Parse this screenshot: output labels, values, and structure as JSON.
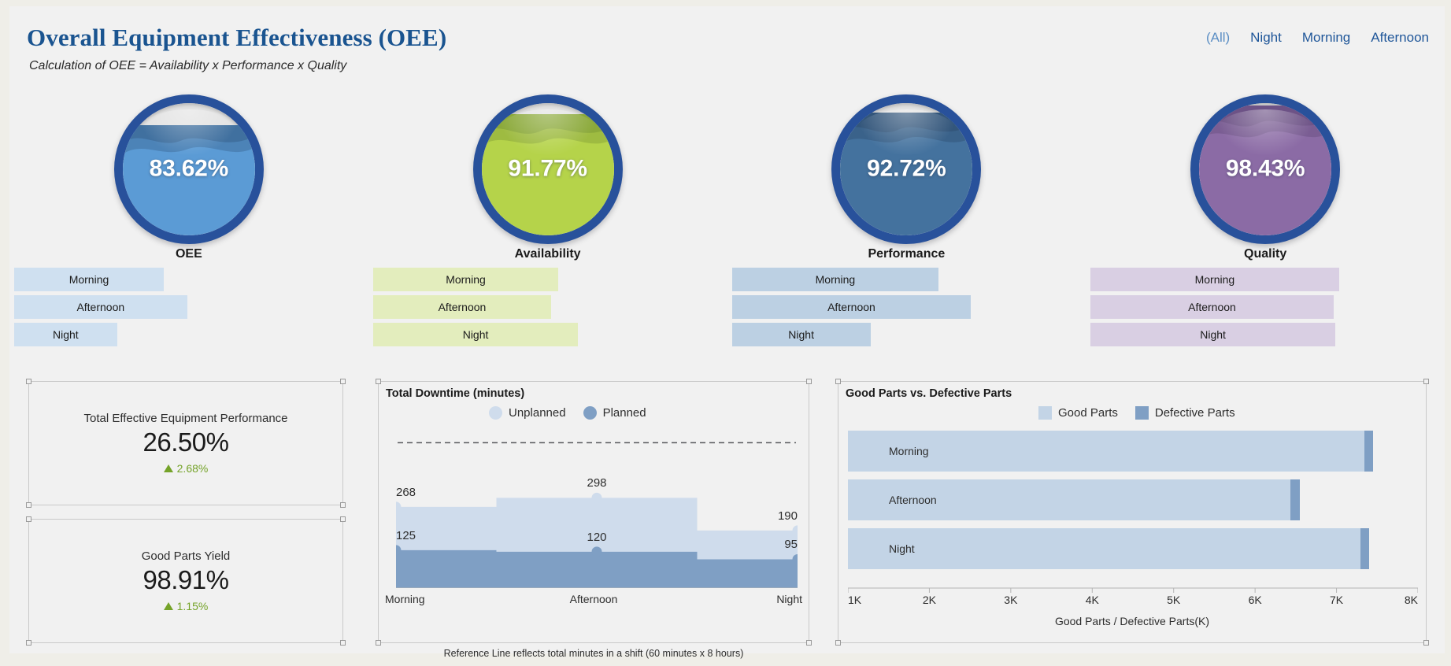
{
  "header": {
    "title": "Overall Equipment Effectiveness (OEE)",
    "subtitle": "Calculation of OEE = Availability x Performance x Quality",
    "filters": [
      {
        "label": "(All)",
        "selected": true
      },
      {
        "label": "Night",
        "selected": false
      },
      {
        "label": "Morning",
        "selected": false
      },
      {
        "label": "Afternoon",
        "selected": false
      }
    ]
  },
  "gauges": [
    {
      "title": "OEE",
      "value": "83.62%",
      "fill_pct": 83.62,
      "color": "#5b9bd5",
      "color_dark": "#3f6f9e",
      "bar_color": "#cfe0f0",
      "shifts": [
        {
          "label": "Morning",
          "width_pct": 43.0
        },
        {
          "label": "Afternoon",
          "width_pct": 49.5
        },
        {
          "label": "Night",
          "width_pct": 30.0
        }
      ]
    },
    {
      "title": "Availability",
      "value": "91.77%",
      "fill_pct": 91.77,
      "color": "#b5d34a",
      "color_dark": "#8aa83a",
      "bar_color": "#e3edbd",
      "shifts": [
        {
          "label": "Morning",
          "width_pct": 53.0
        },
        {
          "label": "Afternoon",
          "width_pct": 51.0
        },
        {
          "label": "Night",
          "width_pct": 58.5
        }
      ]
    },
    {
      "title": "Performance",
      "value": "92.72%",
      "fill_pct": 92.72,
      "color": "#44729e",
      "color_dark": "#33567a",
      "bar_color": "#bcd0e3",
      "shifts": [
        {
          "label": "Morning",
          "width_pct": 59.0
        },
        {
          "label": "Afternoon",
          "width_pct": 68.0
        },
        {
          "label": "Night",
          "width_pct": 40.0
        }
      ]
    },
    {
      "title": "Quality",
      "value": "98.43%",
      "fill_pct": 98.43,
      "color": "#8b6ba5",
      "color_dark": "#6d5285",
      "bar_color": "#d9cfe3",
      "shifts": [
        {
          "label": "Morning",
          "width_pct": 70.5
        },
        {
          "label": "Afternoon",
          "width_pct": 69.0
        },
        {
          "label": "Night",
          "width_pct": 69.5
        }
      ]
    }
  ],
  "kpis": [
    {
      "label": "Total Effective Equipment Performance",
      "value": "26.50%",
      "delta": "2.68%",
      "delta_direction": "up",
      "delta_color": "#75a329"
    },
    {
      "label": "Good Parts Yield",
      "value": "98.91%",
      "delta": "1.15%",
      "delta_direction": "up",
      "delta_color": "#75a329"
    }
  ],
  "downtime_panel": {
    "title": "Total Downtime (minutes)",
    "caption": "Reference Line reflects total minutes in a shift (60 minutes x 8 hours)",
    "legend": [
      {
        "label": "Unplanned",
        "color": "#cfdcec",
        "shape": "circle"
      },
      {
        "label": "Planned",
        "color": "#7f9fc4",
        "shape": "circle"
      }
    ]
  },
  "goodparts_panel": {
    "title": "Good Parts vs. Defective Parts",
    "axis_label": "Good Parts / Defective Parts(K)",
    "legend": [
      {
        "label": "Good Parts",
        "color": "#c3d4e6",
        "shape": "square"
      },
      {
        "label": "Defective Parts",
        "color": "#7f9fc4",
        "shape": "square"
      }
    ]
  },
  "chart_data": [
    {
      "type": "area",
      "id": "total-downtime",
      "title": "Total Downtime (minutes)",
      "subtype": "stepped-area",
      "categories": [
        "Morning",
        "Afternoon",
        "Night"
      ],
      "series": [
        {
          "name": "Unplanned",
          "values": [
            268,
            298,
            190
          ],
          "color": "#cfdcec"
        },
        {
          "name": "Planned",
          "values": [
            125,
            120,
            95
          ],
          "color": "#7f9fc4"
        }
      ],
      "reference_line": {
        "value": 480,
        "label": "Reference Line reflects total minutes in a shift (60 minutes x 8 hours)",
        "style": "dashed"
      },
      "xlabel": "",
      "ylabel": "",
      "ylim": [
        0,
        520
      ],
      "grid": false,
      "legend_position": "top",
      "data_labels": true
    },
    {
      "type": "bar",
      "id": "good-parts-vs-defective",
      "title": "Good Parts vs. Defective Parts",
      "subtype": "stacked-horizontal",
      "categories": [
        "Morning",
        "Afternoon",
        "Night"
      ],
      "series": [
        {
          "name": "Good Parts",
          "values": [
            7340,
            6430,
            7290
          ],
          "color": "#c3d4e6"
        },
        {
          "name": "Defective Parts",
          "values": [
            110,
            120,
            115
          ],
          "color": "#7f9fc4"
        }
      ],
      "xlabel": "Good Parts / Defective Parts(K)",
      "ylabel": "",
      "xlim": [
        1000,
        8000
      ],
      "xticks": [
        "1K",
        "2K",
        "3K",
        "4K",
        "5K",
        "6K",
        "7K",
        "8K"
      ],
      "grid": false,
      "legend_position": "top"
    },
    {
      "type": "bar",
      "id": "oee-by-shift",
      "title": "OEE",
      "subtype": "horizontal",
      "categories": [
        "Morning",
        "Afternoon",
        "Night"
      ],
      "values": [
        43.0,
        49.5,
        30.0
      ],
      "color": "#cfe0f0"
    },
    {
      "type": "bar",
      "id": "availability-by-shift",
      "title": "Availability",
      "subtype": "horizontal",
      "categories": [
        "Morning",
        "Afternoon",
        "Night"
      ],
      "values": [
        53.0,
        51.0,
        58.5
      ],
      "color": "#e3edbd"
    },
    {
      "type": "bar",
      "id": "performance-by-shift",
      "title": "Performance",
      "subtype": "horizontal",
      "categories": [
        "Morning",
        "Afternoon",
        "Night"
      ],
      "values": [
        59.0,
        68.0,
        40.0
      ],
      "color": "#bcd0e3"
    },
    {
      "type": "bar",
      "id": "quality-by-shift",
      "title": "Quality",
      "subtype": "horizontal",
      "categories": [
        "Morning",
        "Afternoon",
        "Night"
      ],
      "values": [
        70.5,
        69.0,
        69.5
      ],
      "color": "#d9cfe3"
    }
  ]
}
